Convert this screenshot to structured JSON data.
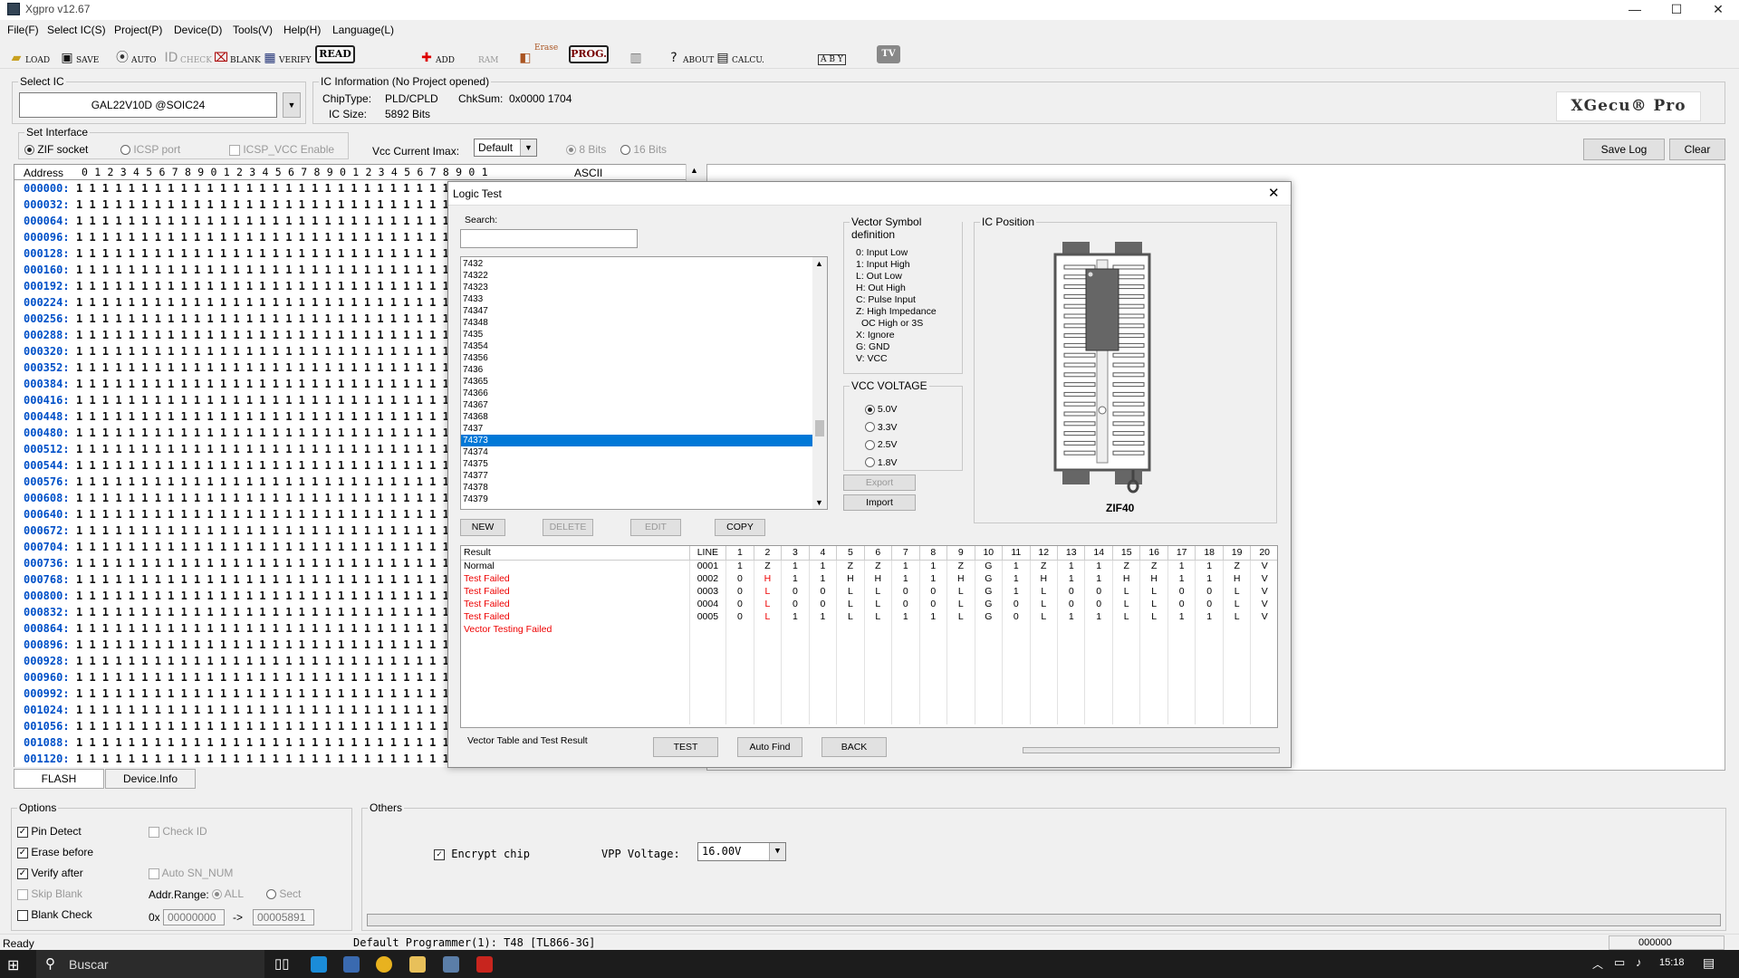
{
  "window": {
    "title": "Xgpro v12.67",
    "minimize": "—",
    "maximize": "☐",
    "close": "✕"
  },
  "menu": [
    "File(F)",
    "Select IC(S)",
    "Project(P)",
    "Device(D)",
    "Tools(V)",
    "Help(H)",
    "Language(L)"
  ],
  "toolbar": {
    "load": "LOAD",
    "save": "SAVE",
    "auto": "AUTO",
    "check": "CHECK",
    "blank": "BLANK",
    "verify": "VERIFY",
    "read": "READ",
    "add": "ADD",
    "ram": "RAM",
    "erase": "Erase",
    "prog": "PROG.",
    "about": "ABOUT",
    "calcu": "CALCU.",
    "tv": "TV",
    "logic": "A B Y"
  },
  "select_ic": {
    "label": "Select IC",
    "value": "GAL22V10D @SOIC24"
  },
  "ic_info": {
    "label": "IC Information (No Project opened)",
    "chip_type_label": "ChipType:",
    "chip_type": "PLD/CPLD",
    "chksum_label": "ChkSum:",
    "chksum": "0x0000 1704",
    "ic_size_label": "IC Size:",
    "ic_size": "5892 Bits",
    "logo": "XGecu® Pro"
  },
  "interface": {
    "label": "Set Interface",
    "zif": "ZIF socket",
    "icsp": "ICSP port",
    "icsp_vcc": "ICSP_VCC Enable",
    "vcc_label": "Vcc Current Imax:",
    "vcc_value": "Default",
    "bits8": "8 Bits",
    "bits16": "16 Bits"
  },
  "log_buttons": {
    "save_log": "Save Log",
    "clear": "Clear"
  },
  "hex": {
    "header_address": "Address",
    "header_cols": "0 1 2 3 4 5 6 7 8 9 0 1 2 3 4 5 6 7 8 9 0 1 2 3 4 5 6 7 8 9 0 1",
    "header_ascii": "ASCII",
    "rows": [
      "000000:",
      "000032:",
      "000064:",
      "000096:",
      "000128:",
      "000160:",
      "000192:",
      "000224:",
      "000256:",
      "000288:",
      "000320:",
      "000352:",
      "000384:",
      "000416:",
      "000448:",
      "000480:",
      "000512:",
      "000544:",
      "000576:",
      "000608:",
      "000640:",
      "000672:",
      "000704:",
      "000736:",
      "000768:",
      "000800:",
      "000832:",
      "000864:",
      "000896:",
      "000928:",
      "000960:",
      "000992:",
      "001024:",
      "001056:",
      "001088:",
      "001120:"
    ],
    "bits": "1 1 1 1 1 1 1 1 1 1 1 1 1 1 1 1 1 1 1 1 1 1 1 1 1 1 1 1 1 1 1 1"
  },
  "tabs": {
    "flash": "FLASH",
    "device_info": "Device.Info"
  },
  "dialog": {
    "title": "Logic Test",
    "close": "✕",
    "search_label": "Search:",
    "list": [
      "7432",
      "74322",
      "74323",
      "7433",
      "74347",
      "74348",
      "7435",
      "74354",
      "74356",
      "7436",
      "74365",
      "74366",
      "74367",
      "74368",
      "7437",
      "74373",
      "74374",
      "74375",
      "74377",
      "74378",
      "74379"
    ],
    "selected": "74373",
    "vector_def": {
      "title": "Vector Symbol definition",
      "lines": [
        "0: Input Low",
        "1: Input High",
        "L: Out Low",
        "H: Out High",
        "C: Pulse Input",
        "Z: High Impedance",
        "OC High or 3S",
        "X: Ignore",
        "G: GND",
        "V: VCC"
      ]
    },
    "vcc": {
      "title": "VCC VOLTAGE",
      "options": [
        "5.0V",
        "3.3V",
        "2.5V",
        "1.8V"
      ],
      "selected": "5.0V"
    },
    "export": "Export",
    "import": "Import",
    "ic_position": {
      "title": "IC Position",
      "socket": "ZIF40"
    },
    "buttons": {
      "new": "NEW",
      "delete": "DELETE",
      "edit": "EDIT",
      "copy": "COPY",
      "test": "TEST",
      "auto_find": "Auto Find",
      "back": "BACK"
    },
    "table": {
      "headers": [
        "Result",
        "LINE",
        "1",
        "2",
        "3",
        "4",
        "5",
        "6",
        "7",
        "8",
        "9",
        "10",
        "11",
        "12",
        "13",
        "14",
        "15",
        "16",
        "17",
        "18",
        "19",
        "20"
      ],
      "rows": [
        {
          "result": "Normal",
          "line": "0001",
          "pins": [
            "1",
            "Z",
            "1",
            "1",
            "Z",
            "Z",
            "1",
            "1",
            "Z",
            "G",
            "1",
            "Z",
            "1",
            "1",
            "Z",
            "Z",
            "1",
            "1",
            "Z",
            "V"
          ]
        },
        {
          "result": "Test Failed",
          "line": "0002",
          "pins": [
            "0",
            "H",
            "1",
            "1",
            "H",
            "H",
            "1",
            "1",
            "H",
            "G",
            "1",
            "H",
            "1",
            "1",
            "H",
            "H",
            "1",
            "1",
            "H",
            "V"
          ]
        },
        {
          "result": "Test Failed",
          "line": "0003",
          "pins": [
            "0",
            "L",
            "0",
            "0",
            "L",
            "L",
            "0",
            "0",
            "L",
            "G",
            "1",
            "L",
            "0",
            "0",
            "L",
            "L",
            "0",
            "0",
            "L",
            "V"
          ]
        },
        {
          "result": "Test Failed",
          "line": "0004",
          "pins": [
            "0",
            "L",
            "0",
            "0",
            "L",
            "L",
            "0",
            "0",
            "L",
            "G",
            "0",
            "L",
            "0",
            "0",
            "L",
            "L",
            "0",
            "0",
            "L",
            "V"
          ]
        },
        {
          "result": "Test Failed",
          "line": "0005",
          "pins": [
            "0",
            "L",
            "1",
            "1",
            "L",
            "L",
            "1",
            "1",
            "L",
            "G",
            "0",
            "L",
            "1",
            "1",
            "L",
            "L",
            "1",
            "1",
            "L",
            "V"
          ]
        }
      ],
      "summary": "Vector Testing Failed"
    },
    "footer_label": "Vector Table and Test Result"
  },
  "options": {
    "label": "Options",
    "pin_detect": "Pin Detect",
    "erase_before": "Erase before",
    "verify_after": "Verify after",
    "skip_blank": "Skip Blank",
    "blank_check": "Blank Check",
    "check_id": "Check ID",
    "auto_sn": "Auto SN_NUM",
    "addr_range": "Addr.Range:",
    "all": "ALL",
    "sect": "Sect",
    "hex_prefix": "0x",
    "from": "00000000",
    "arrow": "->",
    "to": "00005891"
  },
  "others": {
    "label": "Others",
    "encrypt": "Encrypt chip",
    "vpp_label": "VPP Voltage:",
    "vpp_value": "16.00V"
  },
  "status": {
    "ready": "Ready",
    "programmer": "Default Programmer(1): T48 [TL866-3G]",
    "address": "000000"
  },
  "taskbar": {
    "search": "Buscar",
    "time": "15:18"
  }
}
